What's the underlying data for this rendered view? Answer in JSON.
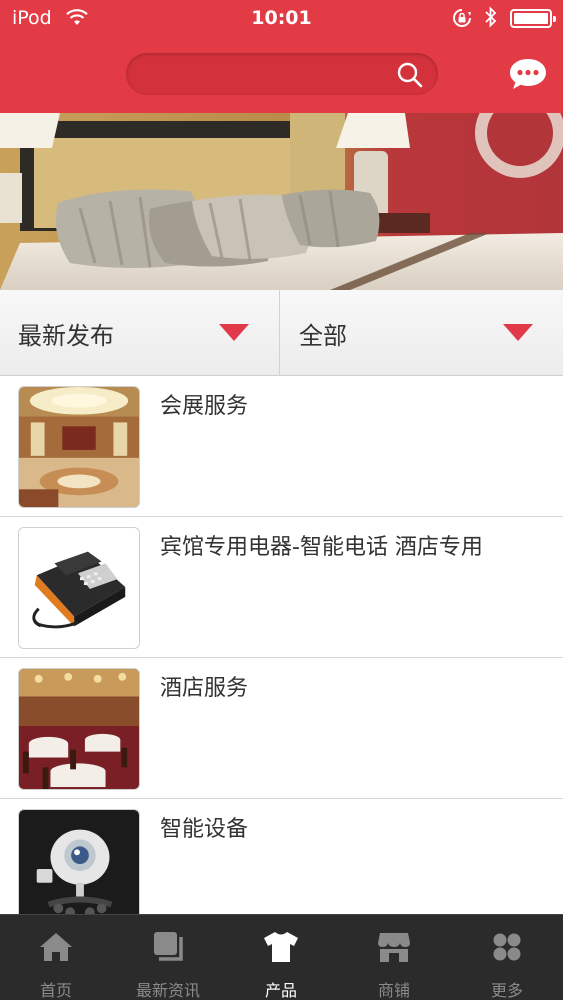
{
  "status_bar": {
    "carrier": "iPod",
    "time": "10:01",
    "icons": [
      "wifi-icon",
      "rotation-lock-icon",
      "bluetooth-icon",
      "battery-icon"
    ]
  },
  "header": {
    "search_placeholder": "",
    "search_icon": "search-icon",
    "chat_icon": "chat-bubble-icon"
  },
  "banner": {
    "image": "hotel bedroom banner"
  },
  "filters": {
    "sort_label": "最新发布",
    "category_label": "全部"
  },
  "products": [
    {
      "title": "会展服务",
      "thumb": "convention-hall"
    },
    {
      "title": "宾馆专用电器-智能电话 酒店专用",
      "thumb": "telephone"
    },
    {
      "title": "酒店服务",
      "thumb": "restaurant"
    },
    {
      "title": "智能设备",
      "thumb": "smart-camera"
    }
  ],
  "tabbar": {
    "tabs": [
      {
        "label": "首页",
        "icon": "home-icon"
      },
      {
        "label": "最新资讯",
        "icon": "news-icon"
      },
      {
        "label": "产品",
        "icon": "tshirt-icon"
      },
      {
        "label": "商铺",
        "icon": "store-icon"
      },
      {
        "label": "更多",
        "icon": "more-grid-icon"
      }
    ],
    "active_index": 2
  },
  "colors": {
    "brand_red": "#e23b45",
    "filter_arrow": "#e2394a",
    "tabbar_bg": "#2b2b2b"
  }
}
